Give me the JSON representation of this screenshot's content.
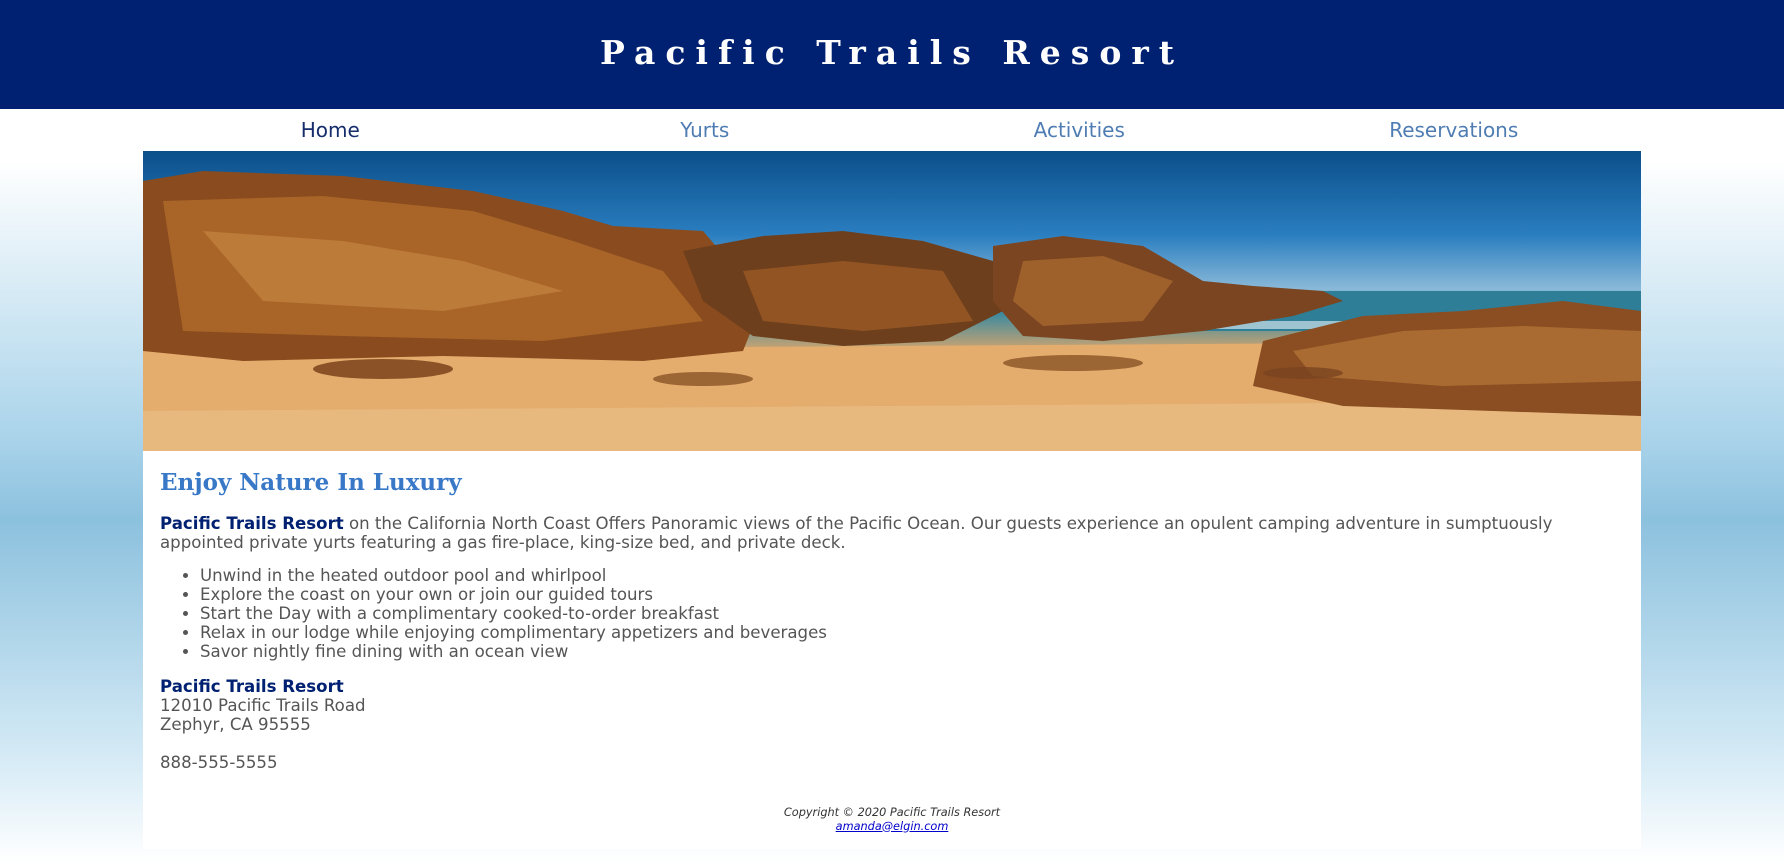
{
  "header": {
    "title": "Pacific Trails Resort"
  },
  "nav": {
    "items": [
      {
        "label": "Home"
      },
      {
        "label": "Yurts"
      },
      {
        "label": "Activities"
      },
      {
        "label": "Reservations"
      }
    ]
  },
  "main": {
    "heading": "Enjoy Nature In Luxury",
    "intro_brand": "Pacific Trails Resort",
    "intro_text": " on the California North Coast Offers Panoramic views of the Pacific Ocean. Our guests experience an opulent camping adventure in sumptuously appointed private yurts featuring a gas fire-place, king-size bed, and private deck.",
    "features": [
      "Unwind in the heated outdoor pool and whirlpool",
      "Explore the coast on your own or join our guided tours",
      "Start the Day with a complimentary cooked-to-order breakfast",
      "Relax in our lodge while enjoying complimentary appetizers and beverages",
      "Savor nightly fine dining with an ocean view"
    ],
    "contact": {
      "name": "Pacific Trails Resort",
      "street": "12010 Pacific Trails Road",
      "city": "Zephyr, CA 95555",
      "phone": "888-555-5555"
    }
  },
  "footer": {
    "copyright": "Copyright © 2020 Pacific Trails Resort",
    "email": "amanda@elgin.com"
  },
  "colors": {
    "header_bg": "#002171",
    "heading": "#3878c7",
    "nav_link": "#4f7db3",
    "brand": "#002171"
  }
}
